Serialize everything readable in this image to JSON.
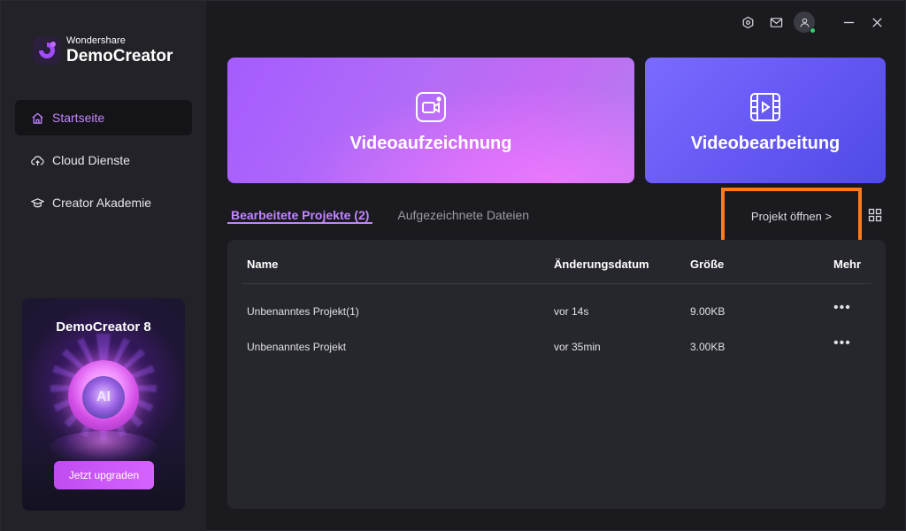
{
  "brand": {
    "company": "Wondershare",
    "product": "DemoCreator"
  },
  "sidebar": {
    "items": [
      {
        "label": "Startseite",
        "icon": "home-icon",
        "active": true
      },
      {
        "label": "Cloud Dienste",
        "icon": "cloud-upload-icon",
        "active": false
      },
      {
        "label": "Creator Akademie",
        "icon": "graduation-cap-icon",
        "active": false
      }
    ],
    "promo": {
      "title": "DemoCreator 8",
      "orb_text": "AI",
      "button_label": "Jetzt upgraden"
    }
  },
  "topbar": {
    "icons": [
      "settings-icon",
      "mail-icon",
      "user-avatar-icon",
      "minimize-icon",
      "close-icon"
    ]
  },
  "cards": {
    "record": {
      "label": "Videoaufzeichnung",
      "icon": "camera-record-icon"
    },
    "edit": {
      "label": "Videobearbeitung",
      "icon": "film-play-icon"
    }
  },
  "tabs": [
    {
      "label": "Bearbeitete Projekte (2)",
      "active": true
    },
    {
      "label": "Aufgezeichnete Dateien",
      "active": false
    }
  ],
  "open_project_label": "Projekt öffnen  >",
  "table": {
    "columns": [
      "Name",
      "Änderungsdatum",
      "Größe",
      "Mehr"
    ],
    "rows": [
      {
        "name": "Unbenanntes Projekt(1)",
        "date": "vor 14s",
        "size": "9.00KB",
        "more": "•••"
      },
      {
        "name": "Unbenanntes Projekt",
        "date": "vor 35min",
        "size": "3.00KB",
        "more": "•••"
      }
    ]
  },
  "colors": {
    "accent": "#c285ff",
    "highlight_box": "#ff7a1a",
    "online": "#2fd36b"
  }
}
